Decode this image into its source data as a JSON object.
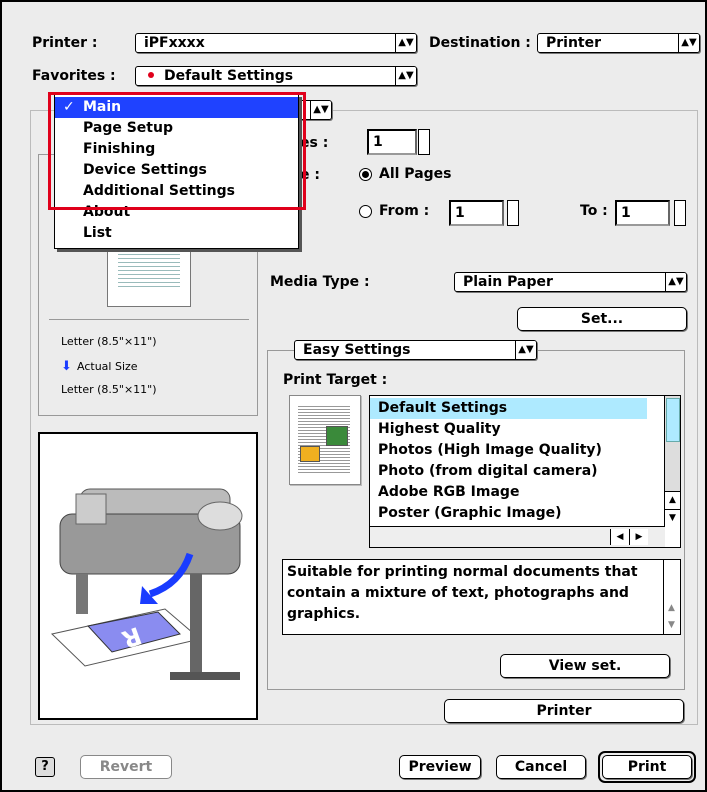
{
  "header": {
    "printer_label": "Printer :",
    "printer_value": "iPFxxxx",
    "destination_label": "Destination :",
    "destination_value": "Printer",
    "favorites_label": "Favorites :",
    "favorites_value": "Default Settings"
  },
  "panel_menu": {
    "items": [
      "Main",
      "Page Setup",
      "Finishing",
      "Device Settings",
      "Additional Settings",
      "About",
      "List"
    ],
    "selected_index": 0
  },
  "copies": {
    "label_partial": "es :",
    "value": "1"
  },
  "pages": {
    "label_partial": "e :",
    "all_pages": "All Pages",
    "from_label": "From :",
    "from_value": "1",
    "to_label": "To :",
    "to_value": "1"
  },
  "preview": {
    "paper_size_1": "Letter (8.5\"×11\")",
    "scale": "Actual Size",
    "paper_size_2": "Letter (8.5\"×11\")"
  },
  "media": {
    "label": "Media Type :",
    "value": "Plain Paper",
    "set_button": "Set..."
  },
  "easy": {
    "mode": "Easy Settings",
    "print_target_label": "Print Target :",
    "targets": [
      "Default Settings",
      "Highest Quality",
      "Photos (High Image Quality)",
      "Photo (from digital camera)",
      "Adobe RGB Image",
      "Poster (Graphic Image)"
    ],
    "selected_index": 0,
    "description": "Suitable for printing normal documents that contain a mixture of text, photographs and graphics.",
    "view_set_button": "View set."
  },
  "footer": {
    "printer_button": "Printer",
    "help_symbol": "?",
    "revert_button": "Revert",
    "preview_button": "Preview",
    "cancel_button": "Cancel",
    "print_button": "Print"
  },
  "colors": {
    "highlight_menu": "#1f42ff",
    "highlight_list": "#aeeaff",
    "annotation_box": "#e0001b",
    "favorites_dot": "#e0001b",
    "arrow_blue": "#1a3cff"
  }
}
